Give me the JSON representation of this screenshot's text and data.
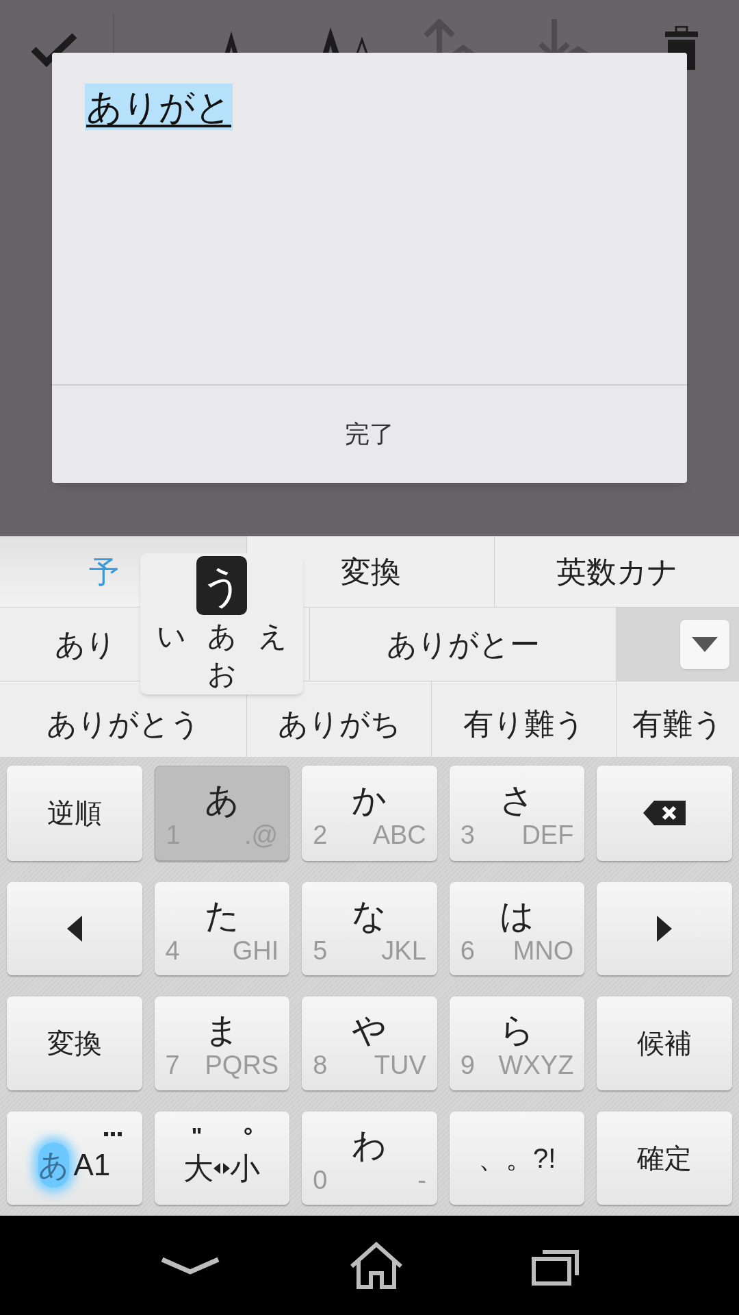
{
  "dialog": {
    "text": "ありがと",
    "button": "完了"
  },
  "tabs": [
    {
      "label": "予",
      "selected": true
    },
    {
      "label": "変換",
      "selected": false
    },
    {
      "label": "英数カナ",
      "selected": false
    }
  ],
  "candidates_row_1": [
    "あり",
    "ありがとー"
  ],
  "candidates_row_2": [
    "ありがとう",
    "ありがち",
    "有り難う",
    "有難う"
  ],
  "flick_popup": [
    {
      "text": "う",
      "selected": true
    },
    {
      "text": "い",
      "selected": false
    },
    {
      "text": "あ",
      "selected": false
    },
    {
      "text": "え",
      "selected": false
    },
    {
      "text": "お",
      "selected": false
    }
  ],
  "keys": [
    {
      "kind": "label",
      "text": "逆順"
    },
    {
      "kind": "kana",
      "main": "あ",
      "number": "1",
      "letters": ".@",
      "pressed": true
    },
    {
      "kind": "kana",
      "main": "か",
      "number": "2",
      "letters": "ABC",
      "pressed": false
    },
    {
      "kind": "kana",
      "main": "さ",
      "number": "3",
      "letters": "DEF",
      "pressed": false
    },
    {
      "kind": "backspace"
    },
    {
      "kind": "left"
    },
    {
      "kind": "kana",
      "main": "た",
      "number": "4",
      "letters": "GHI",
      "pressed": false
    },
    {
      "kind": "kana",
      "main": "な",
      "number": "5",
      "letters": "JKL",
      "pressed": false
    },
    {
      "kind": "kana",
      "main": "は",
      "number": "6",
      "letters": "MNO",
      "pressed": false
    },
    {
      "kind": "right"
    },
    {
      "kind": "label",
      "text": "変換"
    },
    {
      "kind": "kana",
      "main": "ま",
      "number": "7",
      "letters": "PQRS",
      "pressed": false
    },
    {
      "kind": "kana",
      "main": "や",
      "number": "8",
      "letters": "TUV",
      "pressed": false
    },
    {
      "kind": "kana",
      "main": "ら",
      "number": "9",
      "letters": "WXYZ",
      "pressed": false
    },
    {
      "kind": "label",
      "text": "候補"
    },
    {
      "kind": "mode",
      "labels": [
        {
          "text": "あ",
          "selected": true
        },
        {
          "text": "A1",
          "selected": false
        }
      ]
    },
    {
      "kind": "case",
      "marks": [
        "\"",
        "°"
      ],
      "left_text": "大",
      "right_text": "小"
    },
    {
      "kind": "kana",
      "main": "わ",
      "number": "0",
      "letters": "-",
      "pressed": false
    },
    {
      "kind": "label",
      "text": "、。?!"
    },
    {
      "kind": "label",
      "text": "確定"
    }
  ]
}
